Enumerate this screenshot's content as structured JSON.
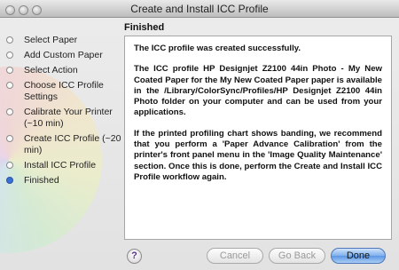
{
  "window": {
    "title": "Create and Install ICC Profile"
  },
  "sidebar": {
    "steps": [
      {
        "label": "Select Paper",
        "state": "done"
      },
      {
        "label": "Add Custom Paper",
        "state": "done"
      },
      {
        "label": "Select Action",
        "state": "done"
      },
      {
        "label": "Choose ICC Profile Settings",
        "state": "done"
      },
      {
        "label": "Calibrate Your Printer (~10 min)",
        "state": "done"
      },
      {
        "label": "Create ICC Profile (~20 min)",
        "state": "done"
      },
      {
        "label": "Install ICC Profile",
        "state": "done"
      },
      {
        "label": "Finished",
        "state": "current"
      }
    ]
  },
  "main": {
    "title": "Finished",
    "paragraphs": [
      "The ICC profile was created successfully.",
      "The ICC profile HP Designjet Z2100 44in Photo - My New Coated Paper for the My New Coated Paper paper is available in the /Library/ColorSync/Profiles/HP Designjet Z2100 44in Photo folder on your computer and can be used from your applications.",
      "If the printed profiling chart shows banding, we recommend that you perform a 'Paper Advance Calibration' from the printer's front panel menu in the 'Image Quality Maintenance' section. Once this is done, perform the Create and Install ICC Profile workflow again."
    ]
  },
  "footer": {
    "help_label": "?",
    "cancel_label": "Cancel",
    "go_back_label": "Go Back",
    "done_label": "Done"
  },
  "colors": {
    "current_step": "#3a6fd6",
    "primary_button": "#5d97e4"
  }
}
